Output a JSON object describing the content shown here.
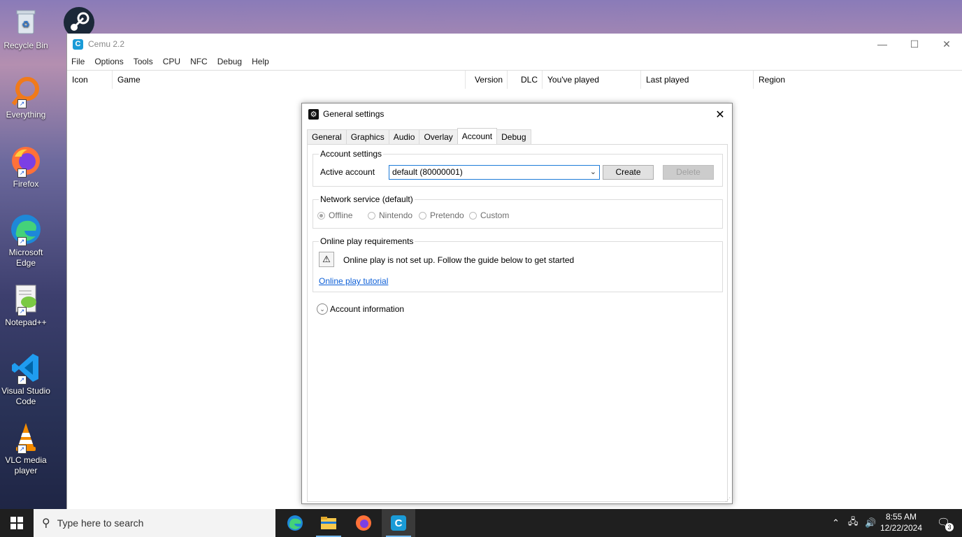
{
  "desktop": {
    "icons": [
      {
        "label": "Recycle Bin"
      },
      {
        "label": "Everything"
      },
      {
        "label": "Firefox"
      },
      {
        "label": "Microsoft Edge"
      },
      {
        "label": "Notepad++"
      },
      {
        "label": "Visual Studio Code"
      },
      {
        "label": "VLC media player"
      }
    ]
  },
  "cemu": {
    "title": "Cemu 2.2",
    "menu": [
      "File",
      "Options",
      "Tools",
      "CPU",
      "NFC",
      "Debug",
      "Help"
    ],
    "columns": [
      "Icon",
      "Game",
      "Version",
      "DLC",
      "You've played",
      "Last played",
      "Region"
    ]
  },
  "dialog": {
    "title": "General settings",
    "tabs": [
      "General",
      "Graphics",
      "Audio",
      "Overlay",
      "Account",
      "Debug"
    ],
    "active_tab": "Account",
    "account_settings": {
      "legend": "Account settings",
      "active_account_label": "Active account",
      "active_account_value": "default (80000001)",
      "create_label": "Create",
      "delete_label": "Delete"
    },
    "network": {
      "legend": "Network service (default)",
      "options": [
        "Offline",
        "Nintendo",
        "Pretendo",
        "Custom"
      ],
      "selected": "Offline"
    },
    "online_play": {
      "legend": "Online play requirements",
      "message": "Online play is not set up. Follow the guide below to get started",
      "link": "Online play tutorial"
    },
    "account_info_label": "Account information"
  },
  "taskbar": {
    "search_placeholder": "Type here to search",
    "time": "8:55 AM",
    "date": "12/22/2024",
    "notification_count": "3"
  },
  "colors": {
    "accent": "#1e7bd8",
    "cemu_icon": "#1a9bd7",
    "link": "#0b5ed7",
    "taskbar": "#1f1f1f"
  }
}
